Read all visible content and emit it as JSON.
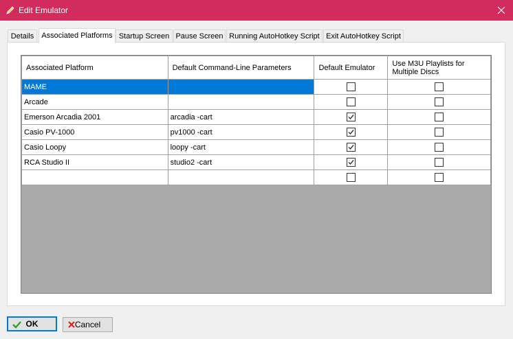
{
  "window": {
    "title": "Edit Emulator",
    "icon": "pencil-icon",
    "close_icon": "close-icon"
  },
  "tabs": [
    {
      "label": "Details",
      "active": false
    },
    {
      "label": "Associated Platforms",
      "active": true
    },
    {
      "label": "Startup Screen",
      "active": false
    },
    {
      "label": "Pause Screen",
      "active": false
    },
    {
      "label": "Running AutoHotkey Script",
      "active": false
    },
    {
      "label": "Exit AutoHotkey Script",
      "active": false
    }
  ],
  "grid": {
    "columns": {
      "platform": "Associated Platform",
      "params": "Default Command-Line Parameters",
      "default": "Default Emulator",
      "m3u": "Use M3U Playlists for Multiple Discs"
    },
    "rows": [
      {
        "platform": "MAME",
        "params": "",
        "default": false,
        "m3u": false,
        "selected": true
      },
      {
        "platform": "Arcade",
        "params": "",
        "default": false,
        "m3u": false,
        "selected": false
      },
      {
        "platform": "Emerson Arcadia 2001",
        "params": "arcadia -cart",
        "default": true,
        "m3u": false,
        "selected": false
      },
      {
        "platform": "Casio PV-1000",
        "params": "pv1000 -cart",
        "default": true,
        "m3u": false,
        "selected": false
      },
      {
        "platform": "Casio Loopy",
        "params": "loopy -cart",
        "default": true,
        "m3u": false,
        "selected": false
      },
      {
        "platform": "RCA Studio II",
        "params": "studio2 -cart",
        "default": true,
        "m3u": false,
        "selected": false
      },
      {
        "platform": "",
        "params": "",
        "default": false,
        "m3u": false,
        "selected": false
      }
    ]
  },
  "buttons": {
    "ok": "OK",
    "cancel": "Cancel"
  },
  "colors": {
    "titlebar": "#d22c5c",
    "selection": "#0078d7",
    "grid_empty": "#ababab",
    "ok_icon": "#2e9e2e",
    "cancel_icon": "#e02020"
  }
}
